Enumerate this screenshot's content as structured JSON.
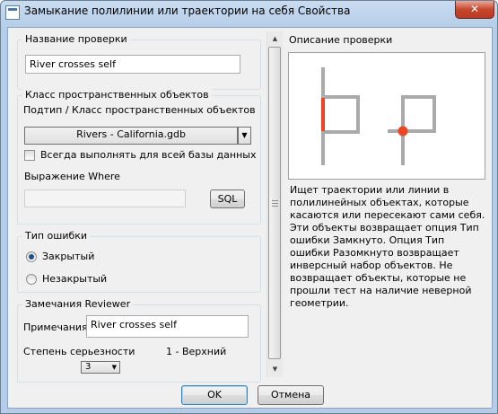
{
  "window": {
    "title": "Замыкание полилинии или траектории на себя Свойства",
    "close_glyph": "✕"
  },
  "check_name": {
    "group_label": "Название проверки",
    "value": "River crosses self"
  },
  "feature_class": {
    "group_label": "Класс пространственных объектов",
    "subtype_label": "Подтип / Класс пространственных объектов",
    "selected": "Rivers -  California.gdb",
    "run_all_label": "Всегда выполнять для всей базы данных",
    "where_label": "Выражение Where",
    "where_value": "",
    "sql_button": "SQL"
  },
  "error_type": {
    "group_label": "Тип ошибки",
    "options": [
      "Закрытый",
      "Незакрытый"
    ],
    "selected": "Закрытый"
  },
  "reviewer_notes": {
    "group_label": "Замечания Reviewer",
    "notes_label": "Примечания",
    "notes_value": "River crosses self",
    "severity_label": "Степень серьезности",
    "severity_value": "3",
    "severity_hint": "1 - Верхний"
  },
  "description": {
    "group_label": "Описание проверки",
    "text": "Ищет траектории или линии в полилинейных объектах, которые касаются или пересекают сами себя. Эти объекты возвращает опция Тип ошибки Замкнуто. Опция Тип ошибки Разомкнуто возвращает инверсный набор объектов. Не возвращает объекты, которые не прошли тест на наличие неверной геометрии.",
    "highlight_color": "#ee4422",
    "line_color": "#aaaaaa"
  },
  "buttons": {
    "ok": "OK",
    "cancel": "Отмена"
  }
}
